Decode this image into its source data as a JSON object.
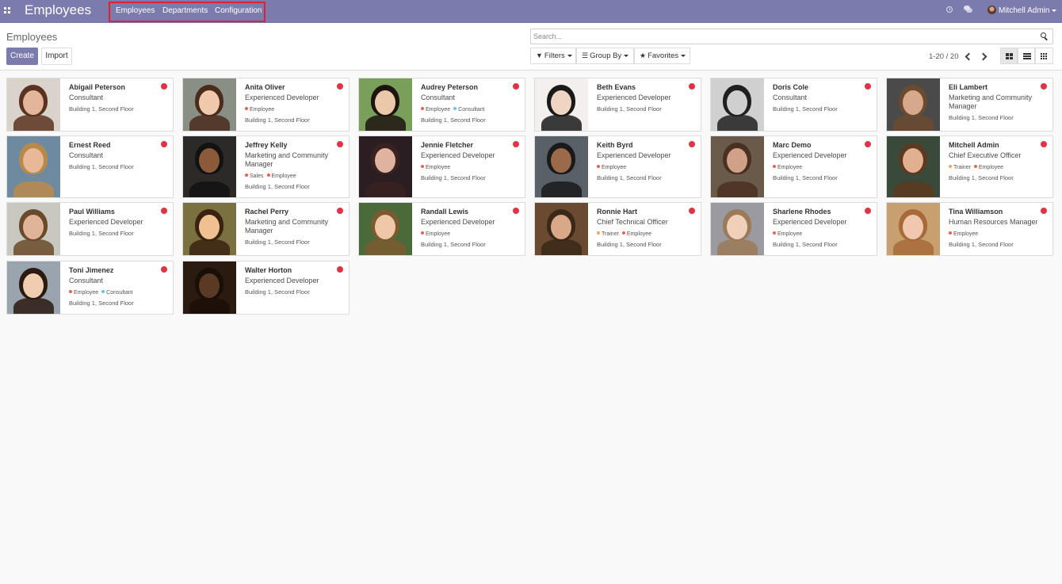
{
  "navbar": {
    "app_title": "Employees",
    "menu": [
      "Employees",
      "Departments",
      "Configuration"
    ],
    "user_name": "Mitchell Admin"
  },
  "control_panel": {
    "breadcrumb": "Employees",
    "create_label": "Create",
    "import_label": "Import",
    "search_placeholder": "Search...",
    "filters_label": "Filters",
    "groupby_label": "Group By",
    "favorites_label": "Favorites",
    "pager_text": "1-20 / 20",
    "active_view": "kanban"
  },
  "colors": {
    "brand": "#7c7bad",
    "presence": "#dc3545",
    "tag_employee": "#f06050",
    "tag_consultant": "#6cc1ed",
    "tag_trainer": "#f4a460",
    "tag_sales": "#f06050"
  },
  "employees": [
    {
      "name": "Abigail Peterson",
      "job": "Consultant",
      "tags": [],
      "location": "Building 1, Second Floor"
    },
    {
      "name": "Anita Oliver",
      "job": "Experienced Developer",
      "tags": [
        "Employee"
      ],
      "location": "Building 1, Second Floor"
    },
    {
      "name": "Audrey Peterson",
      "job": "Consultant",
      "tags": [
        "Employee",
        "Consultant"
      ],
      "location": "Building 1, Second Floor"
    },
    {
      "name": "Beth Evans",
      "job": "Experienced Developer",
      "tags": [],
      "location": "Building 1, Second Floor"
    },
    {
      "name": "Doris Cole",
      "job": "Consultant",
      "tags": [],
      "location": "Building 1, Second Floor"
    },
    {
      "name": "Eli Lambert",
      "job": "Marketing and Community Manager",
      "tags": [],
      "location": "Building 1, Second Floor"
    },
    {
      "name": "Ernest Reed",
      "job": "Consultant",
      "tags": [],
      "location": "Building 1, Second Floor"
    },
    {
      "name": "Jeffrey Kelly",
      "job": "Marketing and Community Manager",
      "tags": [
        "Sales",
        "Employee"
      ],
      "location": "Building 1, Second Floor"
    },
    {
      "name": "Jennie Fletcher",
      "job": "Experienced Developer",
      "tags": [
        "Employee"
      ],
      "location": "Building 1, Second Floor"
    },
    {
      "name": "Keith Byrd",
      "job": "Experienced Developer",
      "tags": [
        "Employee"
      ],
      "location": "Building 1, Second Floor"
    },
    {
      "name": "Marc Demo",
      "job": "Experienced Developer",
      "tags": [
        "Employee"
      ],
      "location": "Building 1, Second Floor"
    },
    {
      "name": "Mitchell Admin",
      "job": "Chief Executive Officer",
      "tags": [
        "Trainer",
        "Employee"
      ],
      "location": "Building 1, Second Floor"
    },
    {
      "name": "Paul Williams",
      "job": "Experienced Developer",
      "tags": [],
      "location": "Building 1, Second Floor"
    },
    {
      "name": "Rachel Perry",
      "job": "Marketing and Community Manager",
      "tags": [],
      "location": "Building 1, Second Floor"
    },
    {
      "name": "Randall Lewis",
      "job": "Experienced Developer",
      "tags": [
        "Employee"
      ],
      "location": "Building 1, Second Floor"
    },
    {
      "name": "Ronnie Hart",
      "job": "Chief Technical Officer",
      "tags": [
        "Trainer",
        "Employee"
      ],
      "location": "Building 1, Second Floor"
    },
    {
      "name": "Sharlene Rhodes",
      "job": "Experienced Developer",
      "tags": [
        "Employee"
      ],
      "location": "Building 1, Second Floor"
    },
    {
      "name": "Tina Williamson",
      "job": "Human Resources Manager",
      "tags": [
        "Employee"
      ],
      "location": "Building 1, Second Floor"
    },
    {
      "name": "Toni Jimenez",
      "job": "Consultant",
      "tags": [
        "Employee",
        "Consultant"
      ],
      "location": "Building 1, Second Floor"
    },
    {
      "name": "Walter Horton",
      "job": "Experienced Developer",
      "tags": [],
      "location": "Building 1, Second Floor"
    }
  ]
}
